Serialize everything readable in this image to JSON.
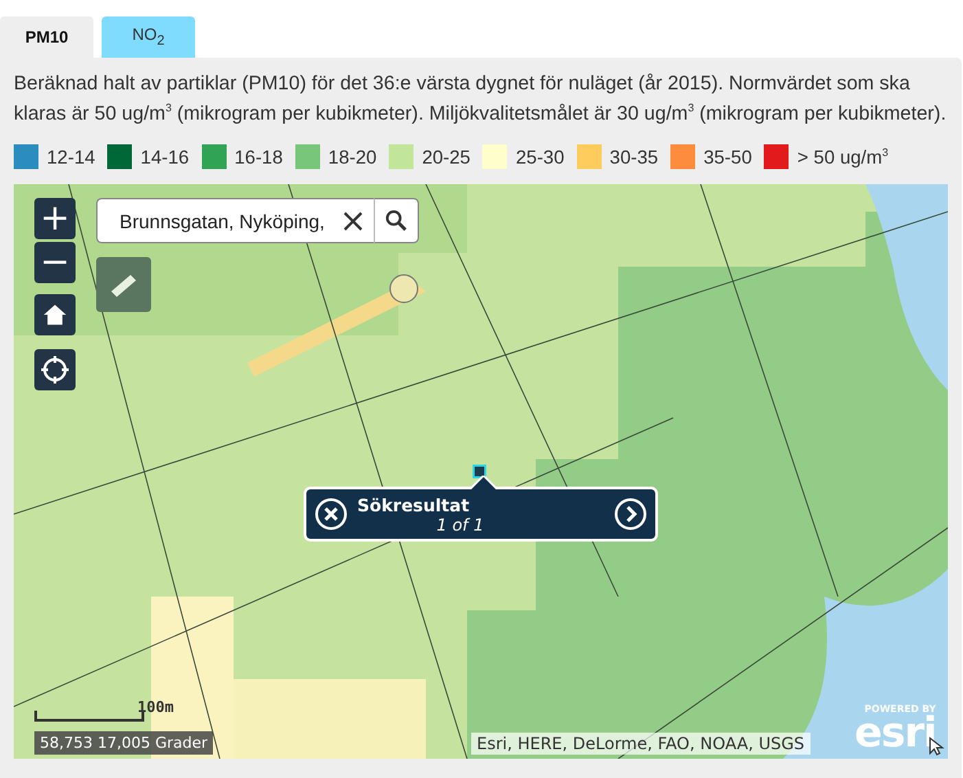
{
  "tabs": [
    {
      "label": "PM10",
      "selected": true
    },
    {
      "label": "NO$_{2}$",
      "selected": false
    }
  ],
  "description": "Beräknad halt av partiklar (PM10) för det 36:e värsta dygnet för nuläget (år 2015). Normvärdet som ska klaras är 50 ug/m$^{3}$ (mikrogram per kubikmeter). Miljökvalitetsmålet är 30 ug/m$^{3}$ (mikrogram per kubikmeter).",
  "legend": [
    {
      "label": "12-14",
      "color": "#2b8cbe"
    },
    {
      "label": "14-16",
      "color": "#006837"
    },
    {
      "label": "16-18",
      "color": "#31a354"
    },
    {
      "label": "18-20",
      "color": "#78c679"
    },
    {
      "label": "20-25",
      "color": "#c2e699"
    },
    {
      "label": "25-30",
      "color": "#ffffcc"
    },
    {
      "label": "30-35",
      "color": "#fecc5c"
    },
    {
      "label": "35-50",
      "color": "#fd8d3c"
    },
    {
      "label": "> 50 ug/m$^{3}$",
      "color": "#e31a1c"
    }
  ],
  "map": {
    "kind": "picture",
    "zoom_in": "+",
    "zoom_out": "−",
    "search": {
      "value": "Brunnsgatan, Nyköping,"
    },
    "popup": {
      "title": "Sökresultat",
      "count": "1 of 1"
    },
    "scale": "100m",
    "coordinates": "58,753 17,005 Grader",
    "attribution": "Esri, HERE, DeLorme, FAO, NOAA, USGS",
    "powered_by": "POWERED BY",
    "logo": "esri"
  }
}
